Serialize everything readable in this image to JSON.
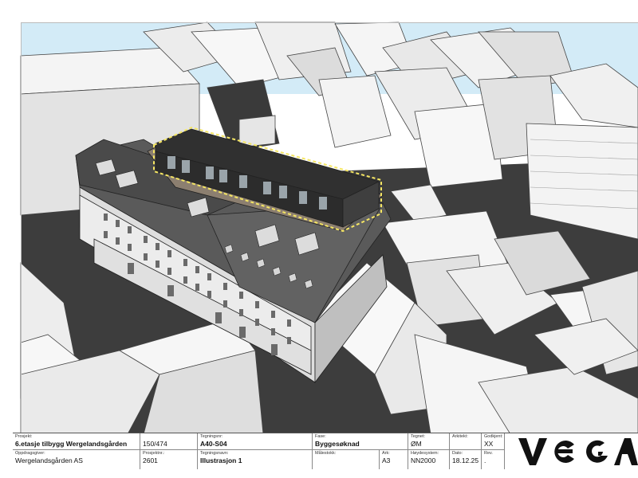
{
  "title_block": {
    "row1": [
      {
        "caption": "Prosjekt:",
        "value": "6.etasje tilbygg Wergelandsgården",
        "bold": true
      },
      {
        "caption": "",
        "value": "150/474",
        "bold": false
      },
      {
        "caption": "Tegningsnr:",
        "value": "A40-S04",
        "bold": true
      },
      {
        "caption": "Fase:",
        "value": "Byggesøknad",
        "bold": true
      },
      {
        "caption": "Tegnet:",
        "value": "ØM",
        "bold": false
      },
      {
        "caption": "Arkitekt:",
        "value": "",
        "bold": false
      },
      {
        "caption": "Godkjent:",
        "value": "XX",
        "bold": false
      }
    ],
    "row2": [
      {
        "caption": "Oppdragsgiver:",
        "value": "Wergelandsgården AS",
        "bold": false
      },
      {
        "caption": "Prosjektnr.:",
        "value": "2601",
        "bold": false
      },
      {
        "caption": "Tegningsnavn:",
        "value": "Illustrasjon 1",
        "bold": true
      },
      {
        "caption": "Målestokk:",
        "value": "",
        "bold": false
      },
      {
        "caption": "Ark:",
        "value": "A3",
        "bold": false
      },
      {
        "caption": "Høydesystem:",
        "value": "NN2000",
        "bold": false
      },
      {
        "caption": "Dato:",
        "value": "18.12.25",
        "bold": false
      },
      {
        "caption": "Rev.",
        "value": ".",
        "bold": false
      }
    ],
    "logo_text": "VEGA"
  },
  "colors": {
    "sky": "#d3ebf7",
    "roof_dark": "#3a3a3a",
    "building_white": "#f2f2f2",
    "shadow": "#3c3c3c",
    "highlight": "#f5e663"
  }
}
